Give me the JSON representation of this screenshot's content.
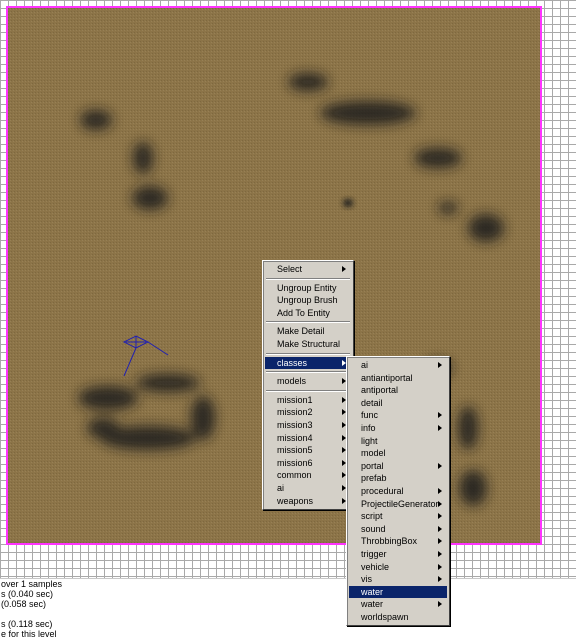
{
  "viewport": {
    "background": "#ffffff",
    "grid_color": "#a9a9a9",
    "terrain_color": "#8c7448",
    "selection_border_color": "#ff33ff"
  },
  "context_menu": {
    "items": [
      {
        "label": "Select",
        "submenu": true
      },
      {
        "separator": true
      },
      {
        "label": "Ungroup Entity"
      },
      {
        "label": "Ungroup Brush"
      },
      {
        "label": "Add To Entity"
      },
      {
        "separator": true
      },
      {
        "label": "Make Detail"
      },
      {
        "label": "Make Structural"
      },
      {
        "separator": true
      },
      {
        "label": "classes",
        "submenu": true,
        "highlighted": true
      },
      {
        "separator": true
      },
      {
        "label": "models",
        "submenu": true
      },
      {
        "separator": true
      },
      {
        "label": "mission1",
        "submenu": true
      },
      {
        "label": "mission2",
        "submenu": true
      },
      {
        "label": "mission3",
        "submenu": true
      },
      {
        "label": "mission4",
        "submenu": true
      },
      {
        "label": "mission5",
        "submenu": true
      },
      {
        "label": "mission6",
        "submenu": true
      },
      {
        "label": "common",
        "submenu": true
      },
      {
        "label": "ai",
        "submenu": true
      },
      {
        "label": "weapons",
        "submenu": true
      }
    ]
  },
  "classes_menu": {
    "items": [
      {
        "label": "ai",
        "submenu": true
      },
      {
        "label": "antiantiportal"
      },
      {
        "label": "antiportal"
      },
      {
        "label": "detail"
      },
      {
        "label": "func",
        "submenu": true
      },
      {
        "label": "info",
        "submenu": true
      },
      {
        "label": "light"
      },
      {
        "label": "model"
      },
      {
        "label": "portal",
        "submenu": true
      },
      {
        "label": "prefab"
      },
      {
        "label": "procedural",
        "submenu": true
      },
      {
        "label": "ProjectileGenerator",
        "submenu": true
      },
      {
        "label": "script",
        "submenu": true
      },
      {
        "label": "sound",
        "submenu": true
      },
      {
        "label": "ThrobbingBox",
        "submenu": true
      },
      {
        "label": "trigger",
        "submenu": true
      },
      {
        "label": "vehicle",
        "submenu": true
      },
      {
        "label": "vis",
        "submenu": true
      },
      {
        "label": "water",
        "highlighted": true
      },
      {
        "label": "water",
        "submenu": true
      },
      {
        "label": "worldspawn"
      }
    ]
  },
  "console": {
    "lines": [
      "over 1 samples",
      "s (0.040 sec)",
      "(0.058 sec)",
      "",
      "s (0.118 sec)",
      "e for this level"
    ]
  }
}
